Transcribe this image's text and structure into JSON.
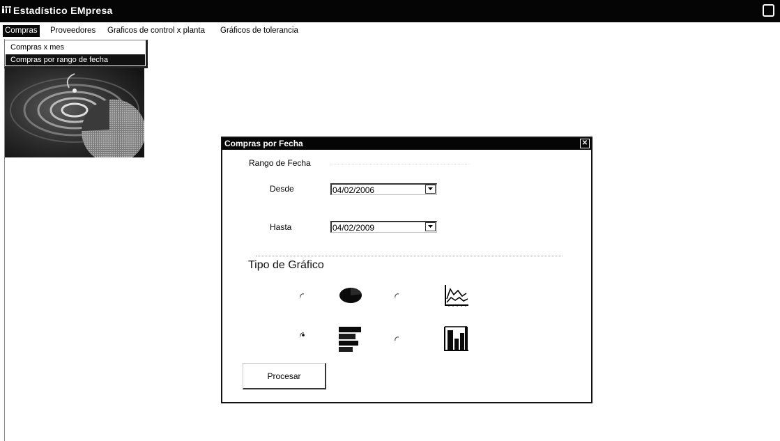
{
  "window": {
    "title": "Estadístico EMpresa"
  },
  "menu": {
    "items": [
      {
        "label": "Compras",
        "active": true
      },
      {
        "label": "Proveedores"
      },
      {
        "label": "Graficos de control x planta"
      },
      {
        "label": "Gráficos de tolerancia"
      }
    ]
  },
  "dropdown": {
    "items": [
      {
        "label": "Compras x mes"
      },
      {
        "label": "Compras por rango de fecha",
        "selected": true
      }
    ]
  },
  "dialog": {
    "title": "Compras por Fecha",
    "range_label": "Rango de Fecha",
    "desde_label": "Desde",
    "desde_value": "04/02/2006",
    "hasta_label": "Hasta",
    "hasta_value": "04/02/2009",
    "tipo_label": "Tipo de Gráfico",
    "chart_options": [
      {
        "icon": "pie-chart-icon",
        "selected": false
      },
      {
        "icon": "line-chart-icon",
        "selected": false
      },
      {
        "icon": "horizontal-bar-chart-icon",
        "selected": true
      },
      {
        "icon": "vertical-bar-chart-icon",
        "selected": false
      }
    ],
    "process_button": "Procesar"
  },
  "colors": {
    "titlebar": "#050505",
    "menu_active": "#0a0a0a",
    "background": "#ffffff"
  }
}
